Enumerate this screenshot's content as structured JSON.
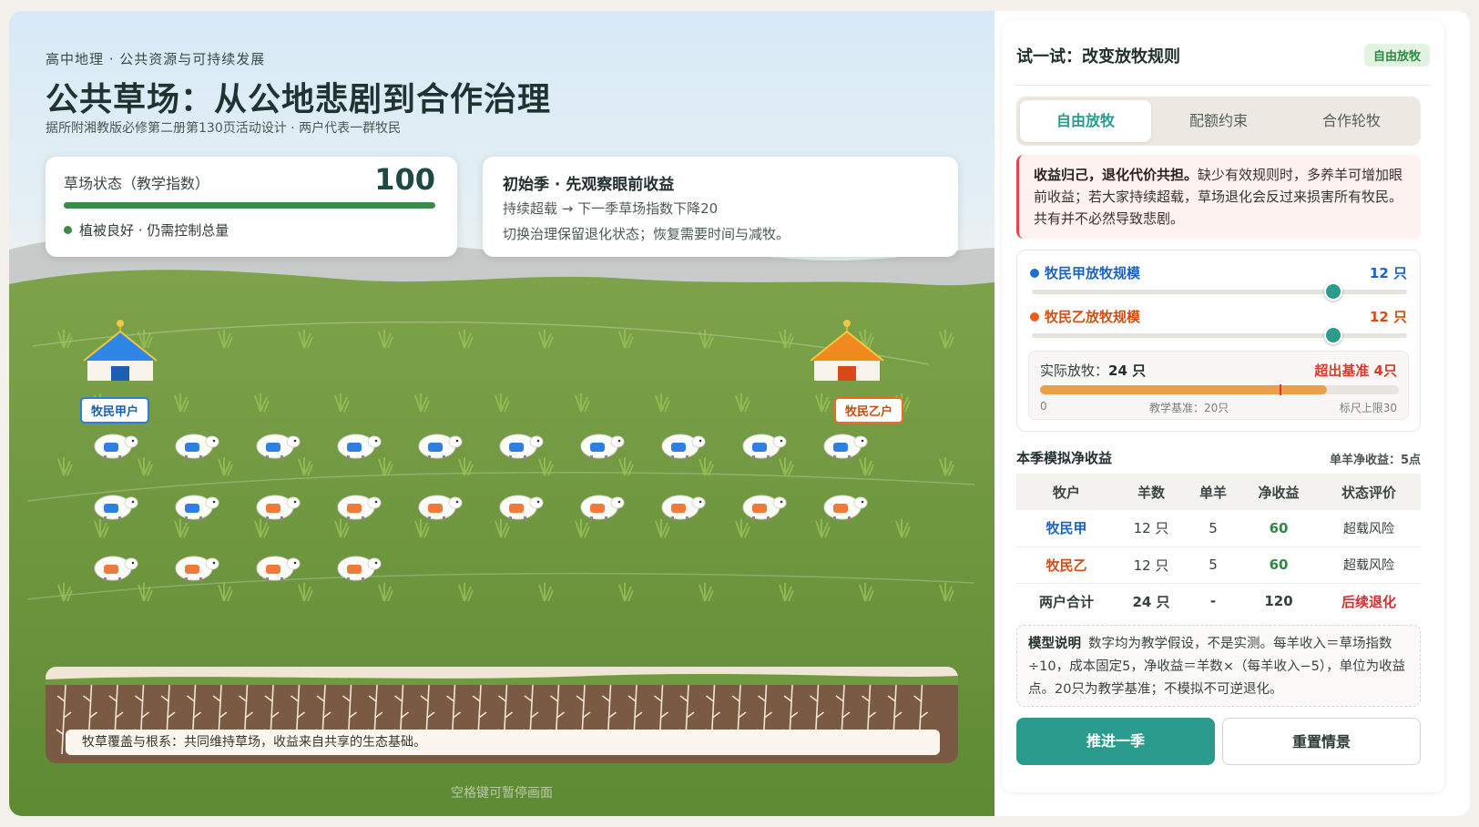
{
  "header": {
    "kicker": "高中地理 · 公共资源与可持续发展",
    "title": "公共草场：从公地悲剧到合作治理",
    "source": "据所附湘教版必修第二册第130页活动设计 · 两户代表一群牧民"
  },
  "status_card": {
    "label": "草场状态（教学指数）",
    "value": "100",
    "index_fraction": 1.0,
    "note": "植被良好 · 仍需控制总量"
  },
  "season_card": {
    "title": "初始季 · 先观察眼前收益",
    "line1": "持续超载 → 下一季草场指数下降20",
    "line2": "切换治理保留退化状态；恢复需要时间与减牧。"
  },
  "yurts": {
    "a_label": "牧民甲户",
    "b_label": "牧民乙户"
  },
  "herd": {
    "blue_count": 12,
    "orange_count": 12,
    "colors": {
      "blue": "#2f7fe0",
      "orange": "#ef7a3a"
    }
  },
  "soil": {
    "caption": "牧草覆盖与根系：共同维持草场，收益来自共享的生态基础。"
  },
  "pause_hint": "空格键可暂停画面",
  "panel": {
    "title": "试一试：改变放牧规则",
    "badge": "自由放牧",
    "tabs": [
      {
        "label": "自由放牧",
        "active": true
      },
      {
        "label": "配额约束",
        "active": false
      },
      {
        "label": "合作轮牧",
        "active": false
      }
    ],
    "alert": {
      "bold": "收益归己，退化代价共担。",
      "text": "缺少有效规则时，多养羊可增加眼前收益；若大家持续超载，草场退化会反过来损害所有牧民。共有并不必然导致悲剧。"
    },
    "sliders": {
      "a": {
        "label": "牧民甲放牧规模",
        "value_text": "12 只",
        "value": 12,
        "max": 15
      },
      "b": {
        "label": "牧民乙放牧规模",
        "value_text": "12 只",
        "value": 12,
        "max": 15
      }
    },
    "actual": {
      "label": "实际放牧：",
      "value": "24 只",
      "over": "超出基准 4只",
      "total": 24,
      "baseline": 20,
      "scale_max": 30,
      "tick_min": "0",
      "tick_base": "教学基准：20只",
      "tick_max": "标尺上限30"
    },
    "table": {
      "title": "本季模拟净收益",
      "note": "单羊净收益：5点",
      "headers": [
        "牧户",
        "羊数",
        "单羊",
        "净收益",
        "状态评价"
      ],
      "rows": [
        {
          "name": "牧民甲",
          "count": "12 只",
          "unit": "5",
          "net": "60",
          "status": "超载风险"
        },
        {
          "name": "牧民乙",
          "count": "12 只",
          "unit": "5",
          "net": "60",
          "status": "超载风险"
        }
      ],
      "total": {
        "name": "两户合计",
        "count": "24 只",
        "unit": "-",
        "net": "120",
        "status": "后续退化"
      }
    },
    "model_note": {
      "label": "模型说明",
      "text": "数字均为教学假设，不是实测。每羊收入＝草场指数÷10，成本固定5，净收益＝羊数×（每羊收入−5），单位为收益点。20只为教学基准；不模拟不可逆退化。"
    },
    "buttons": {
      "advance": "推进一季",
      "reset": "重置情景"
    }
  }
}
